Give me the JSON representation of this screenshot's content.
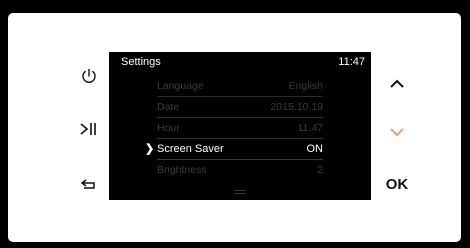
{
  "screen": {
    "title": "Settings",
    "time": "11:47"
  },
  "menu": {
    "items": [
      {
        "label": "Language",
        "value": "English"
      },
      {
        "label": "Date",
        "value": "2015.10.19"
      },
      {
        "label": "Hour",
        "value": "11:47"
      },
      {
        "label": "Screen Saver",
        "value": "ON",
        "selected": true
      },
      {
        "label": "Brightness",
        "value": "2"
      }
    ]
  },
  "buttons": {
    "ok_label": "OK",
    "icons": {
      "power": "power-icon",
      "play_pause": "play-pause-icon",
      "back": "back-icon",
      "up": "chevron-up-icon",
      "down": "chevron-down-icon"
    }
  },
  "colors": {
    "screen_bg": "#000000",
    "bezel": "#ffffff",
    "accent": "#f0a070",
    "dim_text": "#3a3a3a"
  }
}
